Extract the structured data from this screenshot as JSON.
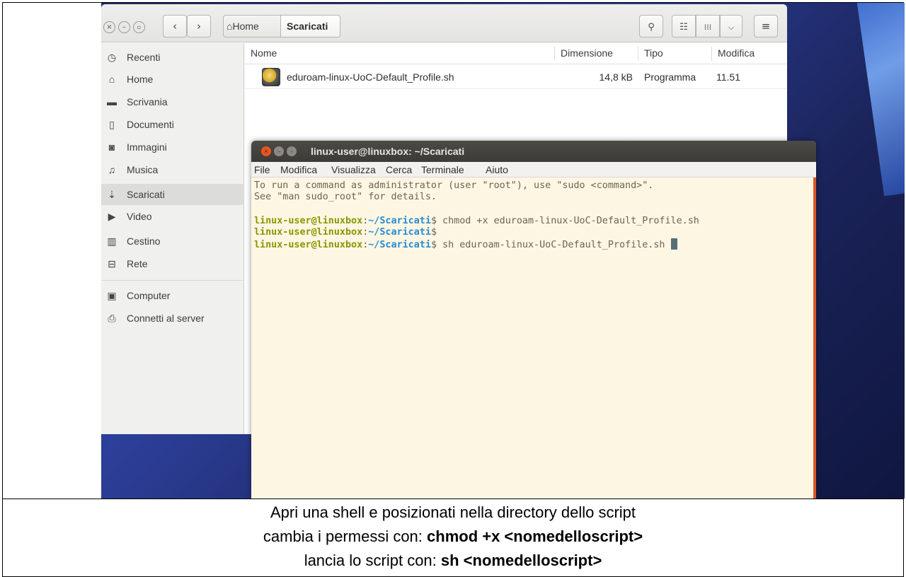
{
  "file_manager": {
    "path": {
      "home_icon": "home-icon",
      "home_label": "Home",
      "current": "Scaricati"
    },
    "headerbar_icons": [
      "close-icon",
      "minimize-icon",
      "maximize-icon",
      "back-icon",
      "forward-icon",
      "search-icon",
      "list-view-icon",
      "grid-view-icon",
      "chevron-down-icon",
      "menu-icon"
    ],
    "sidebar": {
      "items": [
        {
          "label": "Recenti",
          "icon": "clock-icon"
        },
        {
          "label": "Home",
          "icon": "home-icon"
        },
        {
          "label": "Scrivania",
          "icon": "folder-icon"
        },
        {
          "label": "Documenti",
          "icon": "document-icon"
        },
        {
          "label": "Immagini",
          "icon": "camera-icon"
        },
        {
          "label": "Musica",
          "icon": "music-icon"
        },
        {
          "label": "Scaricati",
          "icon": "download-icon",
          "active": true
        },
        {
          "label": "Video",
          "icon": "video-icon"
        },
        {
          "label": "Cestino",
          "icon": "trash-icon"
        },
        {
          "label": "Rete",
          "icon": "network-icon"
        }
      ],
      "devices": [
        {
          "label": "Computer",
          "icon": "computer-icon"
        },
        {
          "label": "Connetti al server",
          "icon": "server-icon"
        }
      ]
    },
    "columns": {
      "name": "Nome",
      "size": "Dimensione",
      "type": "Tipo",
      "modified": "Modifica"
    },
    "files": [
      {
        "name": "eduroam-linux-UoC-Default_Profile.sh",
        "size": "14,8 kB",
        "type": "Programma",
        "modified": "11.51",
        "icon": "script-icon"
      }
    ]
  },
  "terminal": {
    "title": "linux-user@linuxbox: ~/Scaricati",
    "menu": [
      "File",
      "Modifica",
      "Visualizza",
      "Cerca",
      "Terminale",
      "Aiuto"
    ],
    "intro_1": "To run a command as administrator (user \"root\"), use \"sudo <command>\".",
    "intro_2": "See \"man sudo_root\" for details.",
    "prompt_user": "linux-user@linuxbox",
    "prompt_path": "~/Scaricati",
    "prompt_sep": ":",
    "prompt_end": "$",
    "commands": [
      " chmod +x eduroam-linux-UoC-Default_Profile.sh",
      "",
      " sh eduroam-linux-UoC-Default_Profile.sh "
    ],
    "colors": {
      "background": "#fdf6e3",
      "prompt": "#859900",
      "path": "#268bd2",
      "text": "#6f6356"
    }
  },
  "caption": {
    "line1": "Apri una shell e posizionati nella directory dello script",
    "line2_prefix": "cambia i permessi con: ",
    "line2_bold": "chmod +x <nomedelloscript>",
    "line3_prefix": "lancia lo script con: ",
    "line3_bold": "sh <nomedelloscript>"
  }
}
